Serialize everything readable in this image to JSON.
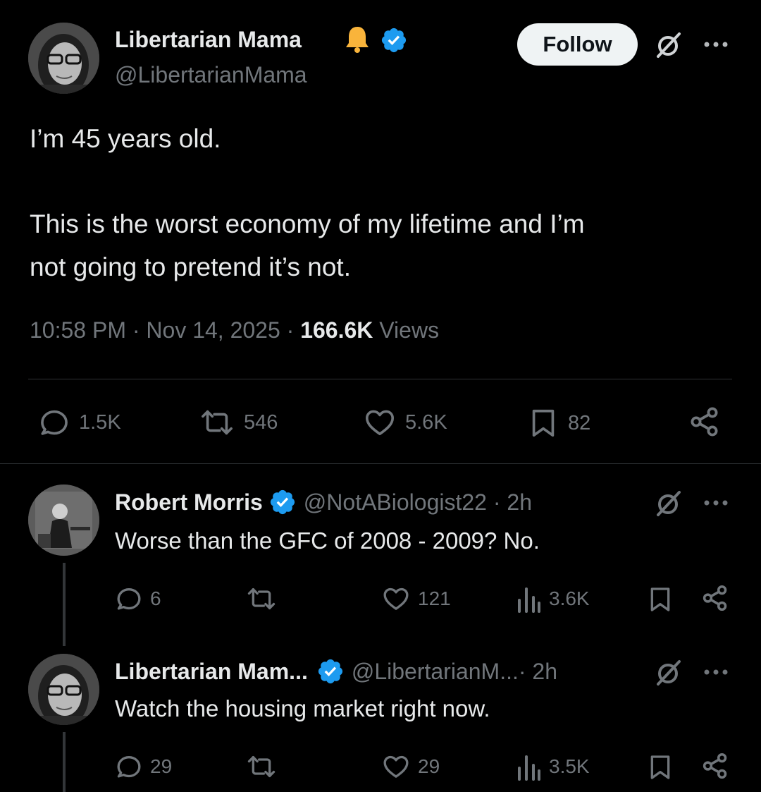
{
  "main_tweet": {
    "author_name": "Libertarian Mama",
    "author_handle": "@LibertarianMama",
    "follow_label": "Follow",
    "text_line1": "I’m 45 years old.",
    "text_line2": "This is the worst economy of my lifetime and I’m",
    "text_line3": "not going to pretend it’s not.",
    "time": "10:58 PM · Nov 14, 2025 · ",
    "views_count": "166.6K",
    "views_label": " Views",
    "replies": "1.5K",
    "reposts": "546",
    "likes": "5.6K",
    "bookmarks": "82"
  },
  "replies": [
    {
      "author_name": "Robert Morris",
      "author_handle": "@NotABiologist22 · 2h",
      "text": "Worse than the GFC of 2008 - 2009? No.",
      "replies": "6",
      "likes": "121",
      "views": "3.6K"
    },
    {
      "author_name": "Libertarian Mam...",
      "author_handle": "@LibertarianM...",
      "time": " · 2h",
      "text": "Watch the housing market right now.",
      "replies": "29",
      "likes": "29",
      "views": "3.5K"
    }
  ],
  "colors": {
    "background": "#000000",
    "text": "#e7e9ea",
    "muted": "#71767b",
    "verified": "#1d9bf0",
    "bell": "#f9b43b",
    "divider": "#2f3336"
  },
  "icons": [
    "bell-icon",
    "verified-badge-icon",
    "grok-icon",
    "more-icon",
    "reply-icon",
    "repost-icon",
    "like-icon",
    "bookmark-icon",
    "share-icon",
    "views-icon"
  ]
}
